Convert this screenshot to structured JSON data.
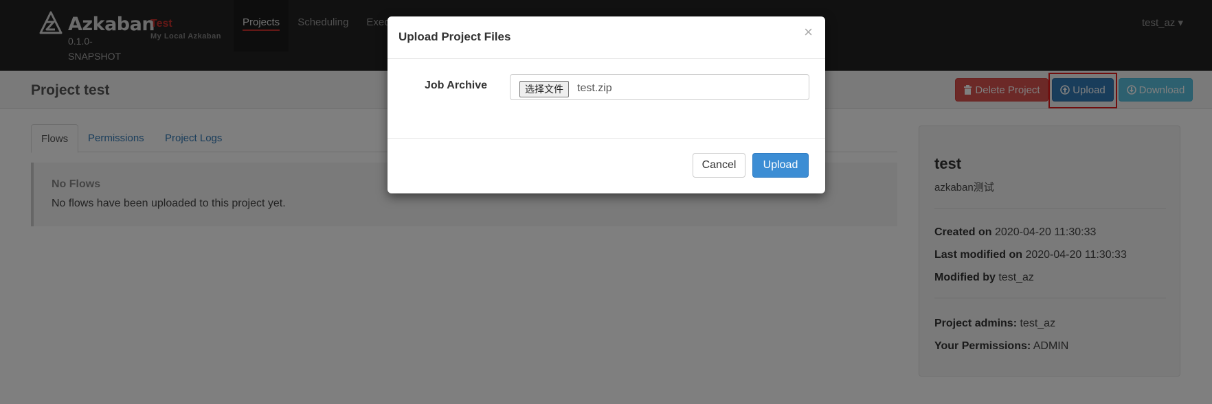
{
  "navbar": {
    "brand": "Azkaban",
    "version": "0.1.0-SNAPSHOT",
    "env_name": "Test",
    "env_desc": "My Local Azkaban",
    "items": [
      {
        "label": "Projects"
      },
      {
        "label": "Scheduling"
      },
      {
        "label": "Executing"
      }
    ],
    "user": "test_az ▾"
  },
  "header": {
    "title": "Project  test",
    "delete_label": "Delete Project",
    "upload_label": "Upload",
    "download_label": "Download"
  },
  "tabs": [
    "Flows",
    "Permissions",
    "Project Logs"
  ],
  "flows": {
    "title": "No  Flows",
    "text": "No flows have been uploaded to this project yet."
  },
  "sidebar": {
    "name": "test",
    "description": "azkaban测试",
    "created_label": "Created on",
    "created_value": "2020-04-20 11:30:33",
    "modified_label": "Last modified on",
    "modified_value": "2020-04-20 11:30:33",
    "modified_by_label": "Modified by",
    "modified_by_value": "test_az",
    "admins_label": "Project admins:",
    "admins_value": "test_az",
    "permissions_label": "Your Permissions:",
    "permissions_value": "ADMIN"
  },
  "modal": {
    "title": "Upload  Project  Files",
    "close": "×",
    "field_label": "Job Archive",
    "file_button": "选择文件",
    "file_name": "test.zip",
    "cancel_label": "Cancel",
    "upload_label": "Upload"
  },
  "colors": {
    "navbar": "#222222",
    "danger": "#d9534f",
    "primary": "#337ab7",
    "info": "#5bc0de",
    "highlight": "#e31b1b"
  }
}
